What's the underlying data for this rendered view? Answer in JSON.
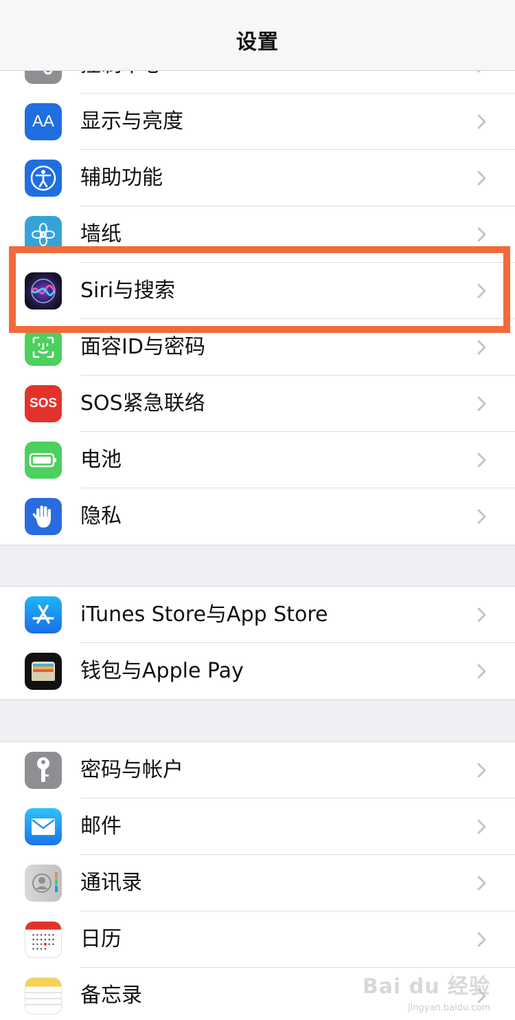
{
  "header": {
    "title": "设置"
  },
  "groups": [
    {
      "items": [
        {
          "label": "控制中心",
          "icon": "control-center-icon",
          "color": "#8e8e93"
        },
        {
          "label": "显示与亮度",
          "icon": "display-brightness-icon",
          "color": "#1f6fe0"
        },
        {
          "label": "辅助功能",
          "icon": "accessibility-icon",
          "color": "#1f6fe0"
        },
        {
          "label": "墙纸",
          "icon": "wallpaper-icon",
          "color": "#36a3d8"
        },
        {
          "label": "Siri与搜索",
          "icon": "siri-icon",
          "color": "#1a1a2e"
        },
        {
          "label": "面容ID与密码",
          "icon": "face-id-icon",
          "color": "#4cd05e"
        },
        {
          "label": "SOS紧急联络",
          "icon": "sos-icon",
          "color": "#e3322c"
        },
        {
          "label": "电池",
          "icon": "battery-icon",
          "color": "#4cd05e"
        },
        {
          "label": "隐私",
          "icon": "privacy-hand-icon",
          "color": "#2a6be0"
        }
      ]
    },
    {
      "items": [
        {
          "label": "iTunes Store与App Store",
          "icon": "app-store-icon",
          "color": "#1e8ef0"
        },
        {
          "label": "钱包与Apple Pay",
          "icon": "wallet-icon",
          "color": "#111111"
        }
      ]
    },
    {
      "items": [
        {
          "label": "密码与帐户",
          "icon": "key-icon",
          "color": "#8e8e93"
        },
        {
          "label": "邮件",
          "icon": "mail-icon",
          "color": "#2b8ef3"
        },
        {
          "label": "通讯录",
          "icon": "contacts-icon",
          "color": "#c8c8c8"
        },
        {
          "label": "日历",
          "icon": "calendar-icon",
          "color": "#ffffff"
        },
        {
          "label": "备忘录",
          "icon": "notes-icon",
          "color": "#ffffff"
        }
      ]
    }
  ],
  "highlight": {
    "target": "Siri与搜索",
    "color": "#f26a3a"
  },
  "watermark": {
    "text": "Bai du 经验",
    "sub": "jingyan.baidu.com"
  }
}
